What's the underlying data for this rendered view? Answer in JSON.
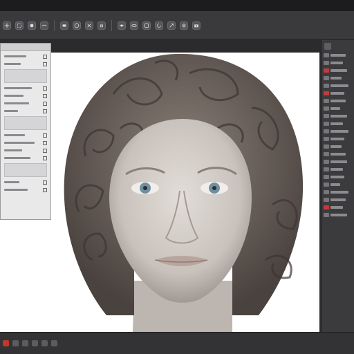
{
  "app": {
    "accent_color": "#c0392b",
    "canvas_background": "#ffffff"
  },
  "toolbar": {
    "icons": [
      "move-icon",
      "select-icon",
      "brush-icon",
      "smooth-icon",
      "clay-icon",
      "inflate-icon",
      "pinch-icon",
      "grab-icon",
      "mask-icon",
      "hide-icon",
      "transform-icon",
      "rotate-icon",
      "scale-icon",
      "symmetry-icon",
      "camera-icon"
    ]
  },
  "canvas": {
    "subject": "sculpted-head"
  },
  "status": {
    "icons": [
      "record-icon",
      "undo-icon",
      "redo-icon",
      "grid-icon",
      "layer-icon",
      "settings-icon"
    ]
  }
}
